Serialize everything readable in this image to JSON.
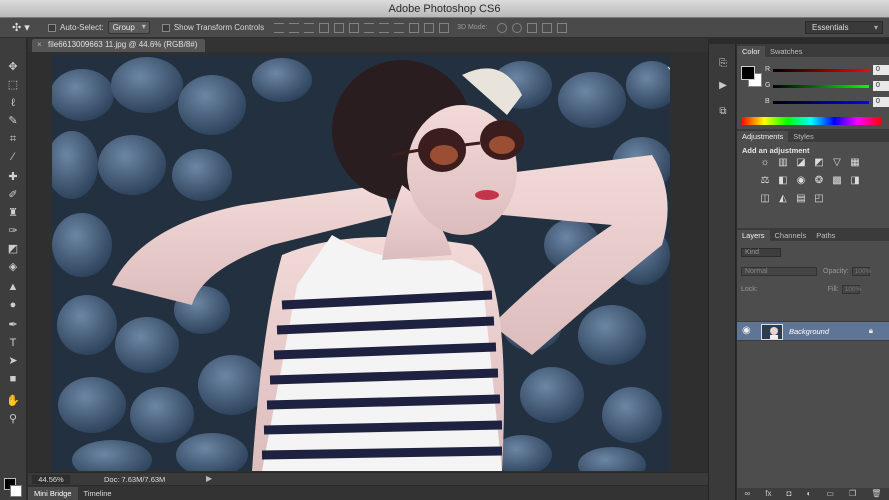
{
  "app": {
    "title": "Adobe Photoshop CS6"
  },
  "options_bar": {
    "tool_icon": "move-tool-icon",
    "auto_select_label": "Auto-Select:",
    "auto_select_value": "Group",
    "show_transform_label": "Show Transform Controls",
    "mode_3d_label": "3D Mode:",
    "workspace": "Essentials"
  },
  "document": {
    "tab_title": "file6613009663 11.jpg @ 44.6% (RGB/8#)",
    "zoom": "44.56%",
    "doc_size": "Doc: 7.63M/7.63M"
  },
  "bottom_tabs": [
    "Mini Bridge",
    "Timeline"
  ],
  "color_panel": {
    "tabs": [
      "Color",
      "Swatches"
    ],
    "channels": [
      {
        "label": "R",
        "value": "0",
        "color": "#ff0000"
      },
      {
        "label": "G",
        "value": "0",
        "color": "#00ff00"
      },
      {
        "label": "B",
        "value": "0",
        "color": "#0000ff"
      }
    ]
  },
  "adjustments_panel": {
    "tabs": [
      "Adjustments",
      "Styles"
    ],
    "title": "Add an adjustment"
  },
  "layers_panel": {
    "tabs": [
      "Layers",
      "Channels",
      "Paths"
    ],
    "kind_filter": "Kind",
    "blend_mode": "Normal",
    "opacity_label": "Opacity:",
    "opacity_value": "100%",
    "lock_label": "Lock:",
    "fill_label": "Fill:",
    "fill_value": "100%",
    "layer_name": "Background"
  },
  "colors": {
    "fg": "#000000",
    "bg": "#ffffff",
    "selected_layer": "#5f7595"
  }
}
